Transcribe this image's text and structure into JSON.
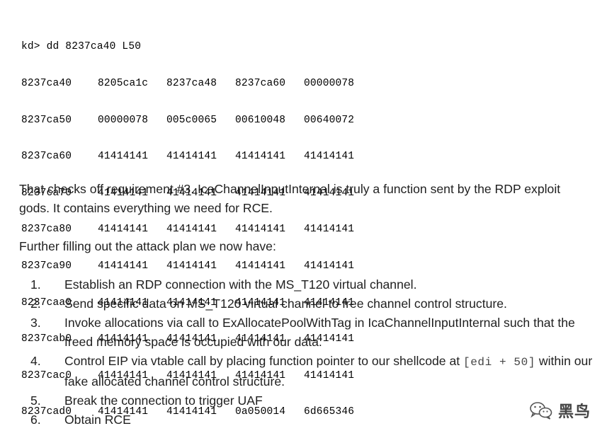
{
  "debugger": {
    "command": "kd> dd 8237ca40 L50",
    "rows": [
      {
        "addr": "8237ca40",
        "w": [
          "8205ca1c",
          "8237ca48",
          "8237ca60",
          "00000078"
        ]
      },
      {
        "addr": "8237ca50",
        "w": [
          "00000078",
          "005c0065",
          "00610048",
          "00640072"
        ]
      },
      {
        "addr": "8237ca60",
        "w": [
          "41414141",
          "41414141",
          "41414141",
          "41414141"
        ]
      },
      {
        "addr": "8237ca70",
        "w": [
          "41414141",
          "41414141",
          "41414141",
          "41414141"
        ]
      },
      {
        "addr": "8237ca80",
        "w": [
          "41414141",
          "41414141",
          "41414141",
          "41414141"
        ]
      },
      {
        "addr": "8237ca90",
        "w": [
          "41414141",
          "41414141",
          "41414141",
          "41414141"
        ]
      },
      {
        "addr": "8237caa0",
        "w": [
          "41414141",
          "41414141",
          "41414141",
          "41414141"
        ]
      },
      {
        "addr": "8237cab0",
        "w": [
          "41414141",
          "41414141",
          "41414141",
          "41414141"
        ]
      },
      {
        "addr": "8237cac0",
        "w": [
          "41414141",
          "41414141",
          "41414141",
          "41414141"
        ]
      },
      {
        "addr": "8237cad0",
        "w": [
          "41414141",
          "41414141",
          "0a050014",
          "6d665346"
        ]
      }
    ]
  },
  "paragraph1": "That checks off requirement #3. IcaChannelInputInternal is truly a function sent by the RDP exploit gods. It contains everything we need for RCE.",
  "paragraph2": "Further filling out the attack plan we now have:",
  "steps": [
    {
      "num": "1.",
      "text": "Establish an RDP connection with the MS_T120 virtual channel."
    },
    {
      "num": "2.",
      "text": "Send specific data on MS_T120 virtual channel to free channel control structure."
    },
    {
      "num": "3.",
      "text": "Invoke allocations via call to ExAllocatePoolWithTag in IcaChannelInputInternal such that the freed memory space is occupied with our data."
    },
    {
      "num": "4.",
      "text_before": "Control EIP via vtable call by placing function pointer to our shellcode at ",
      "code": "[edi + 50]",
      "text_after": " within our fake allocated channel control structure."
    },
    {
      "num": "5.",
      "text": "Break the connection to trigger UAF"
    },
    {
      "num": "6.",
      "text": "Obtain RCE"
    }
  ],
  "watermark": {
    "text": "黑鸟",
    "icon": "wechat-icon"
  }
}
